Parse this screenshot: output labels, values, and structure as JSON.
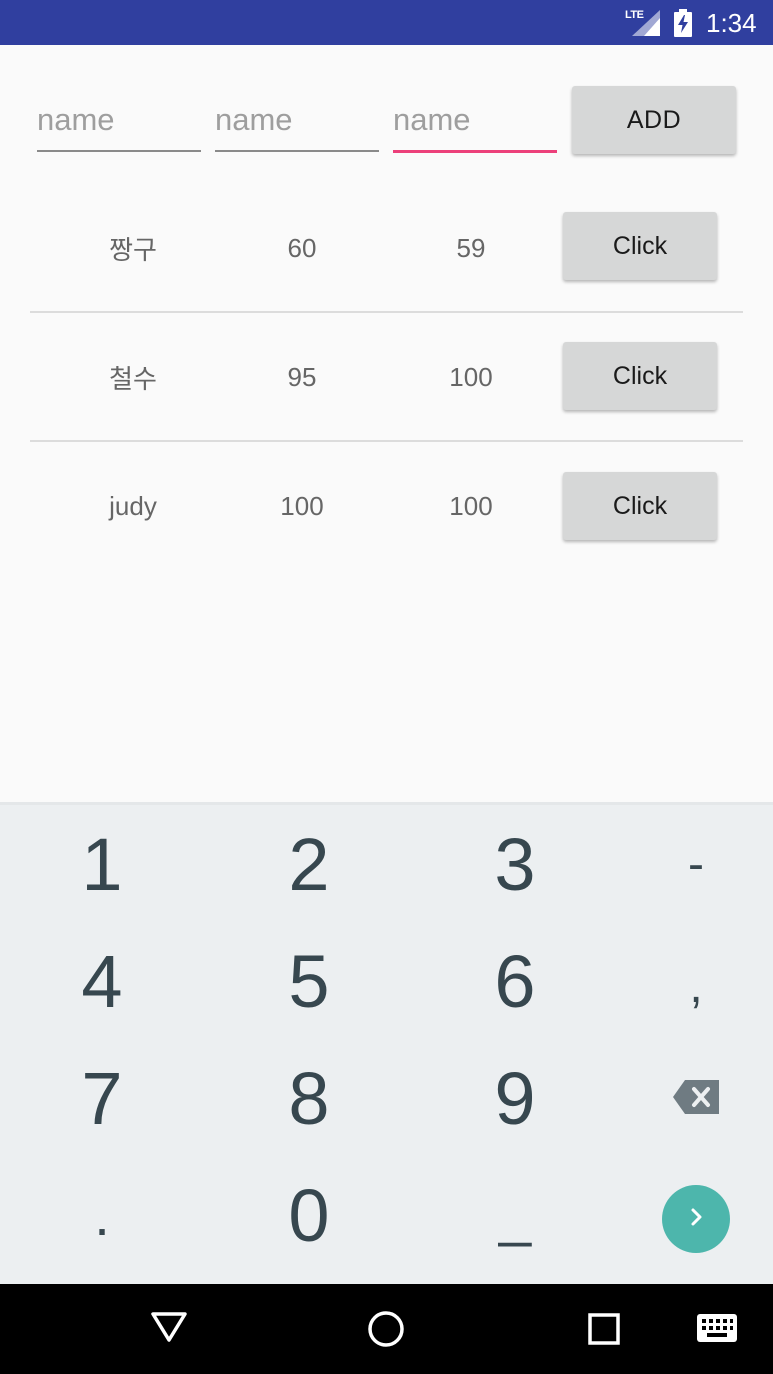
{
  "status_bar": {
    "network": "LTE",
    "time": "1:34"
  },
  "inputs": [
    {
      "placeholder": "name",
      "value": ""
    },
    {
      "placeholder": "name",
      "value": ""
    },
    {
      "placeholder": "name",
      "value": ""
    }
  ],
  "add_button": {
    "label": "ADD"
  },
  "rows": [
    {
      "name": "짱구",
      "score1": "60",
      "score2": "59",
      "button": "Click"
    },
    {
      "name": "철수",
      "score1": "95",
      "score2": "100",
      "button": "Click"
    },
    {
      "name": "judy",
      "score1": "100",
      "score2": "100",
      "button": "Click"
    }
  ],
  "keyboard": {
    "keys": [
      "1",
      "2",
      "3",
      "-",
      "4",
      "5",
      "6",
      ",",
      "7",
      "8",
      "9",
      ".",
      "0",
      "_"
    ],
    "go_icon": "chevron-right-icon",
    "backspace_icon": "backspace-icon"
  },
  "colors": {
    "status_bar": "#303f9f",
    "focus_underline": "#ec407a",
    "go_button": "#4db6ac",
    "key_text": "#37474f"
  }
}
